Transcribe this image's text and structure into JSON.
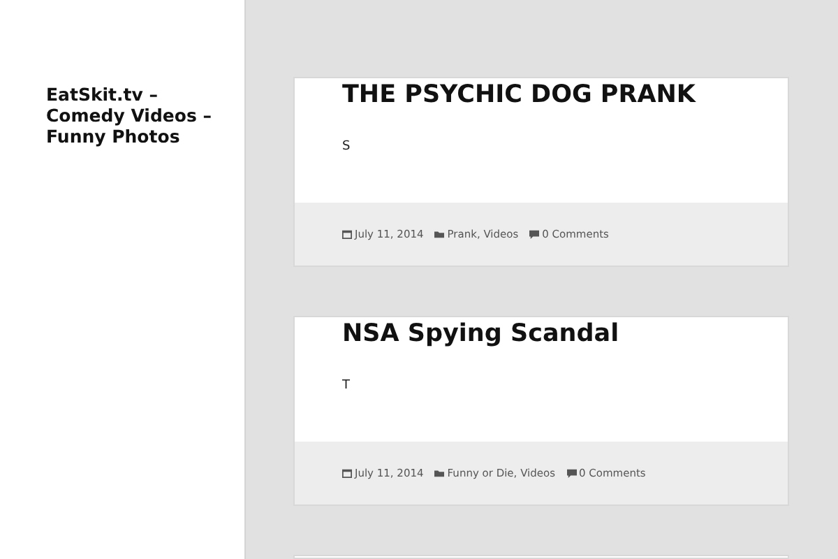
{
  "site_title": "EatSkit.tv – Comedy Videos – Funny Photos",
  "posts": [
    {
      "title": "THE PSYCHIC DOG PRANK",
      "excerpt": "S",
      "date": "July 11, 2014",
      "categories": "Prank, Videos",
      "comments": "0 Comments"
    },
    {
      "title": "NSA Spying Scandal",
      "excerpt": "T",
      "date": "July 11, 2014",
      "categories": "Funny or Die, Videos",
      "comments": "0 Comments"
    }
  ]
}
